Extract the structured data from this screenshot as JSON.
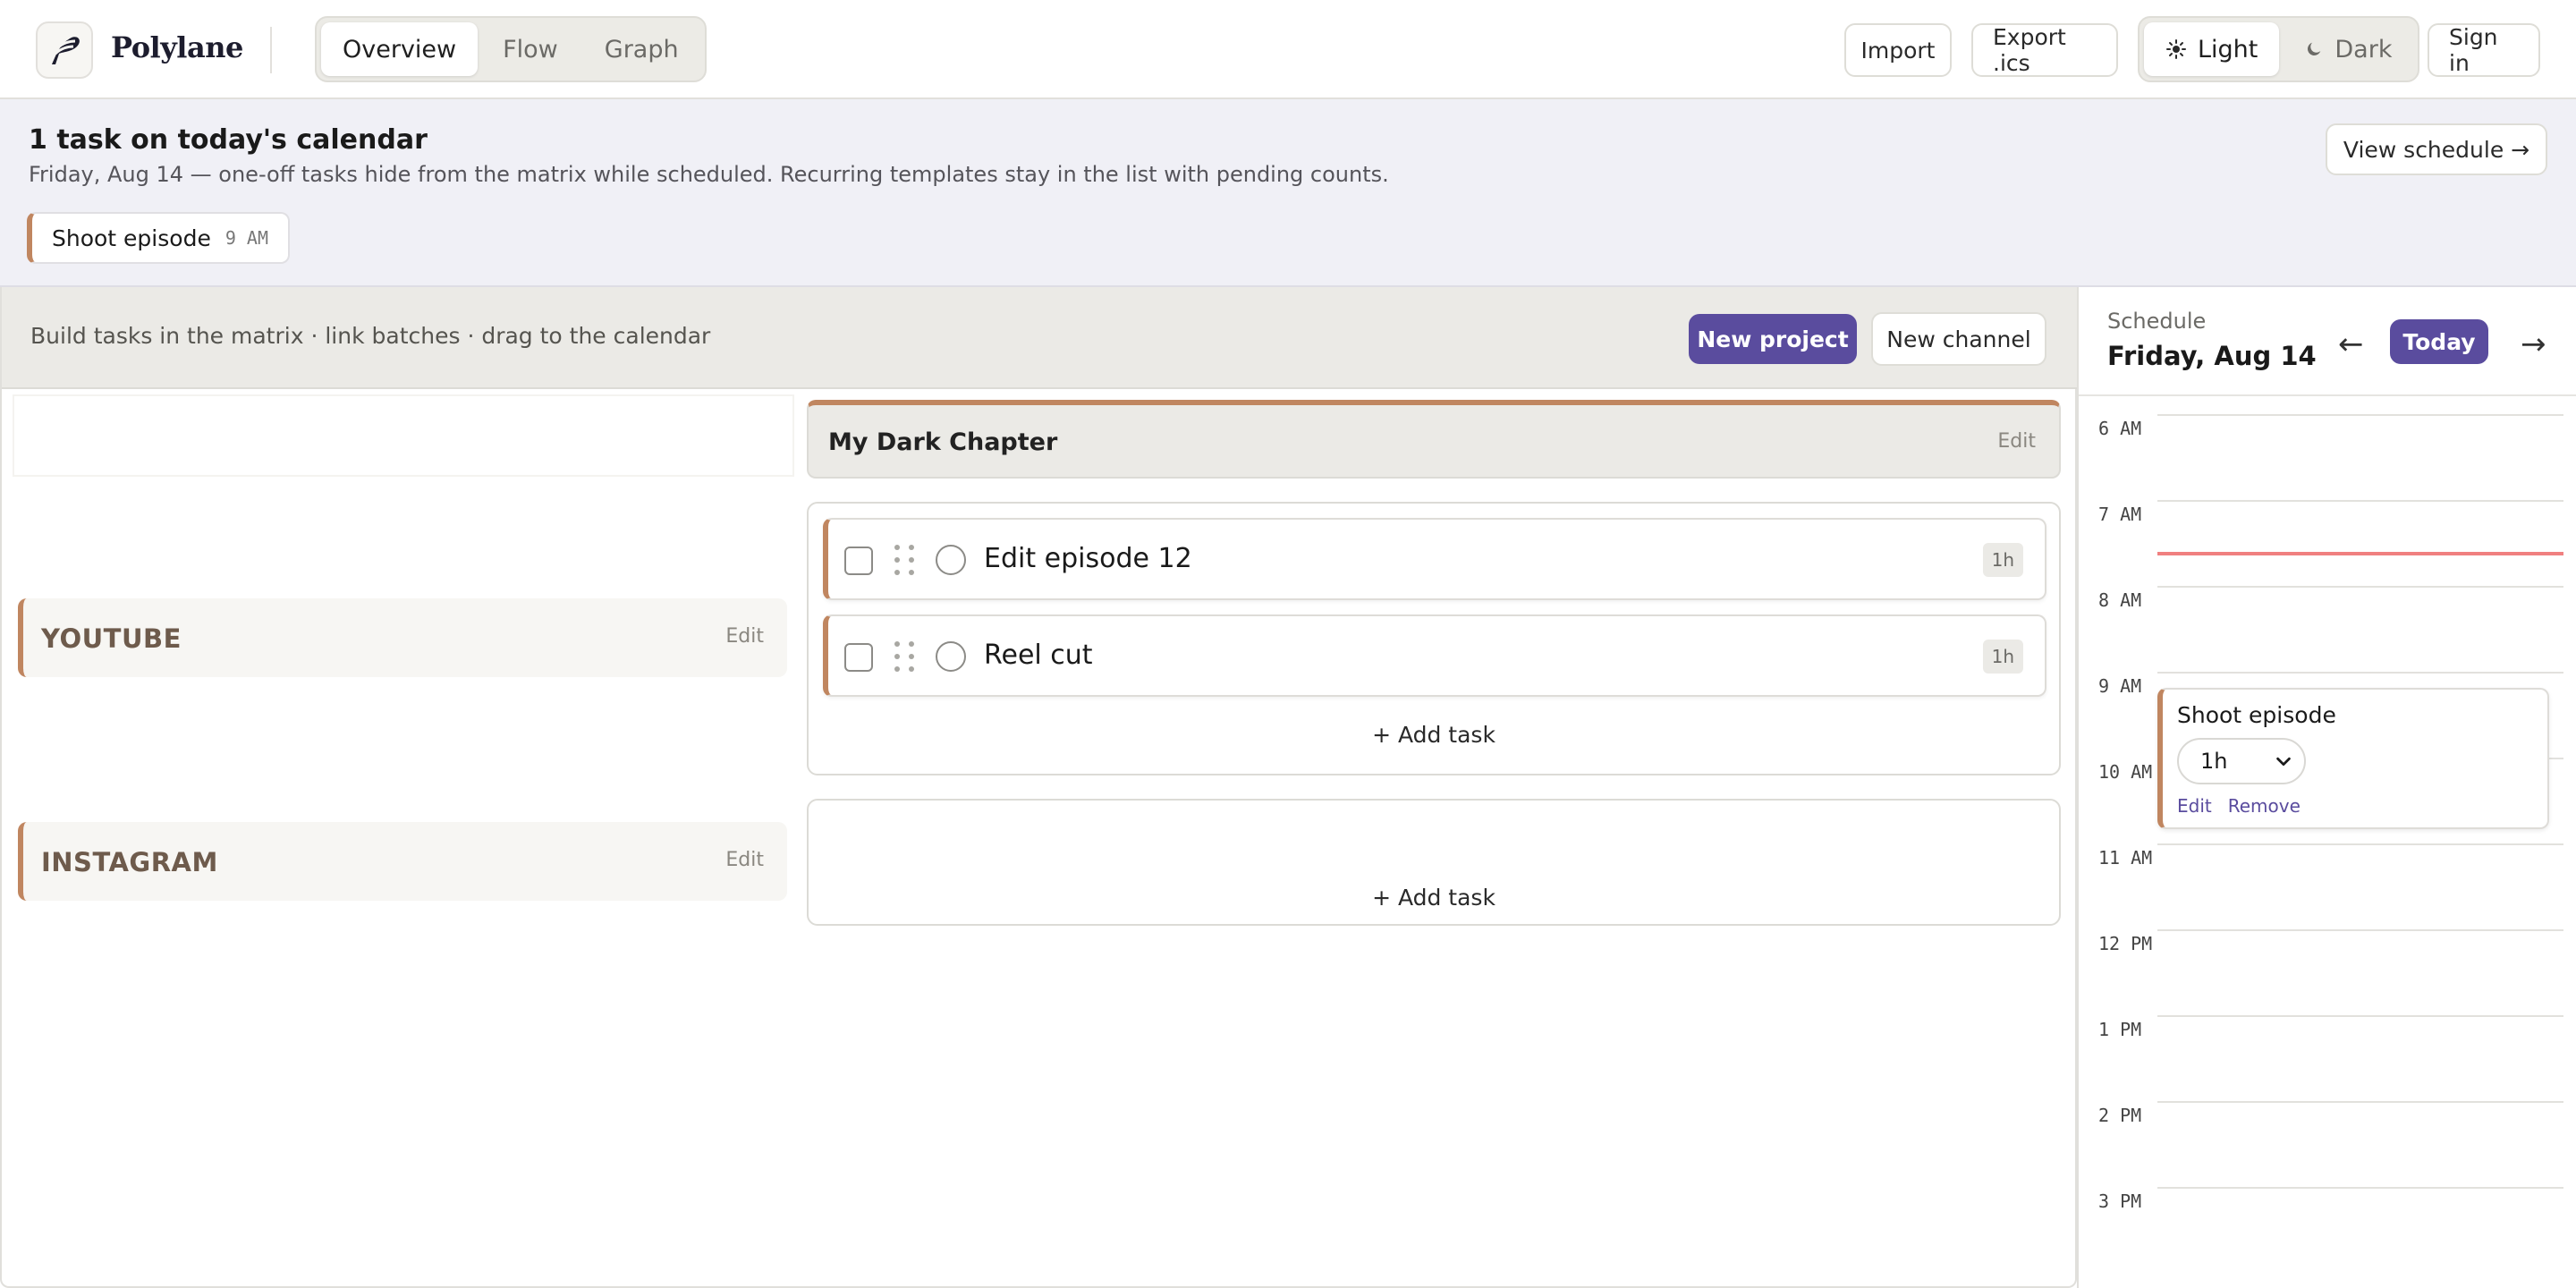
{
  "app": {
    "name": "Polylane"
  },
  "views": {
    "tabs": [
      "Overview",
      "Flow",
      "Graph"
    ],
    "active": "Overview"
  },
  "header_actions": {
    "import": "Import",
    "export": "Export .ics",
    "theme_light": "Light",
    "theme_dark": "Dark",
    "theme_active": "Light",
    "sign_in": "Sign in"
  },
  "banner": {
    "title": "1 task on today's calendar",
    "subtitle": "Friday, Aug 14 — one-off tasks hide from the matrix while scheduled. Recurring templates stay in the list with pending counts.",
    "chip_title": "Shoot episode",
    "chip_time": "9 AM",
    "view_schedule": "View schedule →"
  },
  "toolbar": {
    "hint": "Build tasks in the matrix · link batches · drag to the calendar",
    "new_project": "New project",
    "new_channel": "New channel"
  },
  "matrix": {
    "project": {
      "name": "My Dark Chapter",
      "edit": "Edit"
    },
    "channels": [
      {
        "name": "YOUTUBE",
        "edit": "Edit"
      },
      {
        "name": "INSTAGRAM",
        "edit": "Edit"
      }
    ],
    "tasks": [
      {
        "name": "Edit episode 12",
        "duration": "1h"
      },
      {
        "name": "Reel cut",
        "duration": "1h"
      }
    ],
    "add_task": "+ Add task"
  },
  "schedule": {
    "label": "Schedule",
    "date": "Friday, Aug 14",
    "prev": "←",
    "next": "→",
    "today": "Today",
    "hours": [
      "6 AM",
      "7 AM",
      "8 AM",
      "9 AM",
      "10 AM",
      "11 AM",
      "12 PM",
      "1 PM",
      "2 PM",
      "3 PM"
    ],
    "event": {
      "title": "Shoot episode",
      "duration": "1h",
      "edit": "Edit",
      "remove": "Remove"
    }
  },
  "colors": {
    "accent": "#5a4c9e",
    "channel_accent": "#c08660",
    "now_line": "#f08080",
    "banner_bg": "#f0f0f6"
  },
  "icons": {
    "logo": "polylane-logo-icon",
    "light": "sun-icon",
    "dark": "moon-icon",
    "drag": "drag-handle-icon",
    "select": "chevron-down-icon"
  }
}
